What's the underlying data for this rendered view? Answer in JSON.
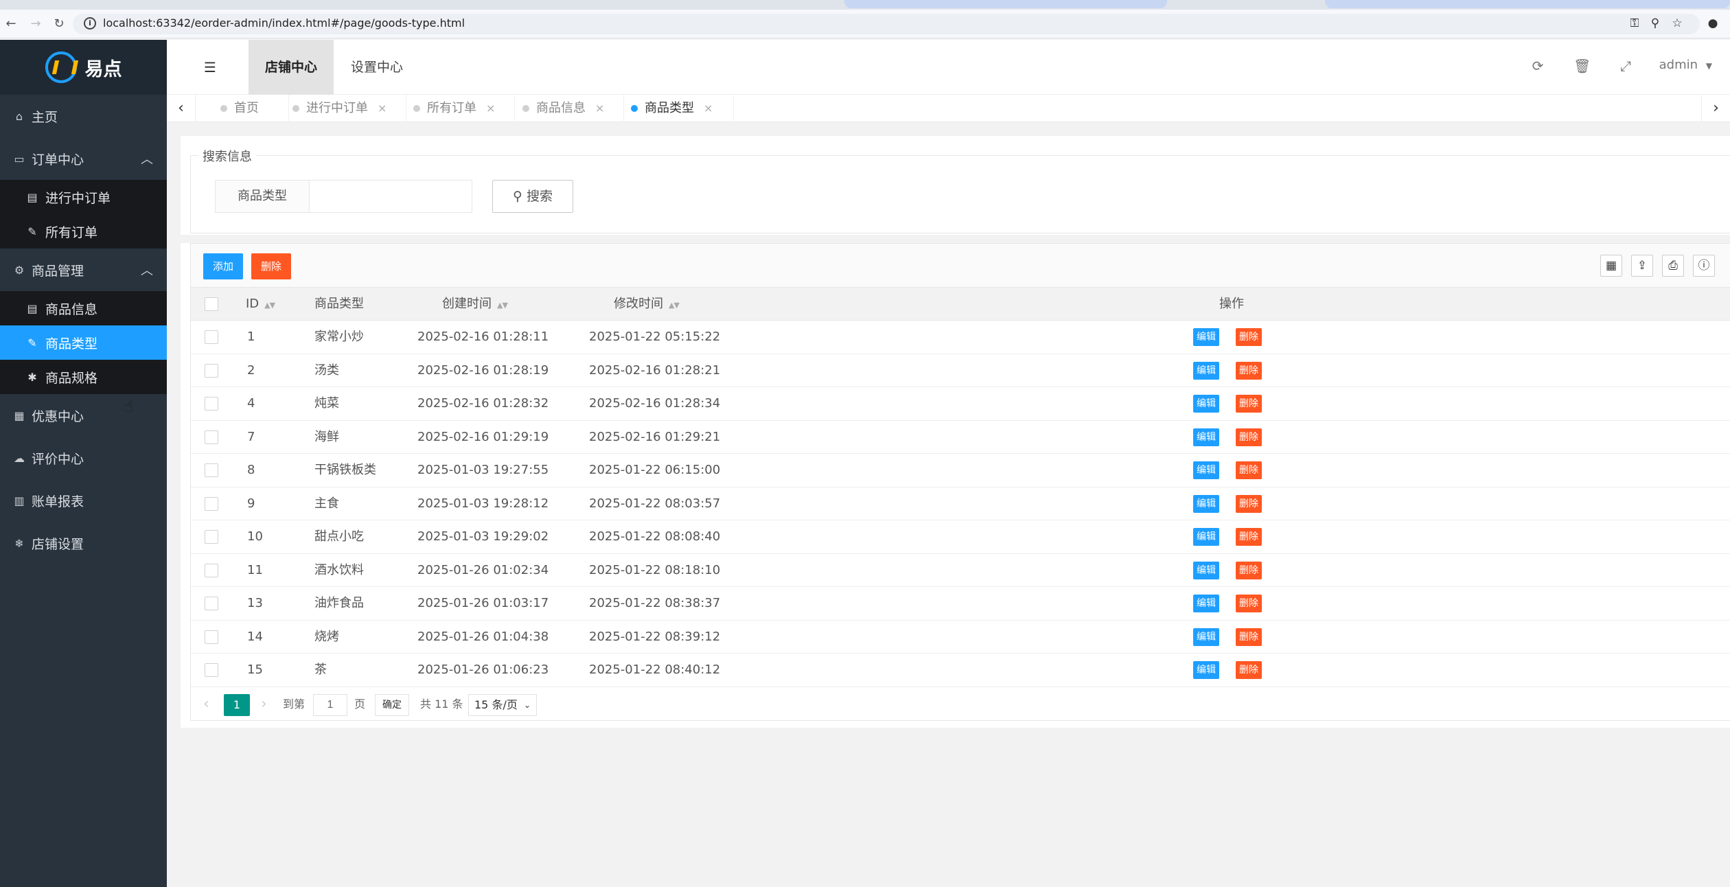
{
  "browser": {
    "url": "localhost:63342/eorder-admin/index.html#/page/goods-type.html"
  },
  "brand": {
    "name": "易点"
  },
  "sidebar": {
    "home": "主页",
    "order_center": "订单中心",
    "order_sub": [
      "进行中订单",
      "所有订单"
    ],
    "goods_manage": "商品管理",
    "goods_sub": [
      "商品信息",
      "商品类型",
      "商品规格"
    ],
    "bottom": [
      "优惠中心",
      "评价中心",
      "账单报表",
      "店铺设置"
    ]
  },
  "header": {
    "tabs": [
      "店铺中心",
      "设置中心"
    ],
    "user": "admin"
  },
  "page_tabs": [
    "首页",
    "进行中订单",
    "所有订单",
    "商品信息",
    "商品类型"
  ],
  "search": {
    "legend": "搜索信息",
    "label": "商品类型",
    "value": "",
    "button": "搜索"
  },
  "toolbar": {
    "add": "添加",
    "delete": "删除"
  },
  "table": {
    "headers": [
      "ID",
      "商品类型",
      "创建时间",
      "修改时间",
      "操作"
    ],
    "edit_label": "编辑",
    "delete_label": "删除",
    "rows": [
      {
        "id": "1",
        "type": "家常小炒",
        "created": "2025-02-16 01:28:11",
        "modified": "2025-01-22 05:15:22"
      },
      {
        "id": "2",
        "type": "汤类",
        "created": "2025-02-16 01:28:19",
        "modified": "2025-02-16 01:28:21"
      },
      {
        "id": "4",
        "type": "炖菜",
        "created": "2025-02-16 01:28:32",
        "modified": "2025-02-16 01:28:34"
      },
      {
        "id": "7",
        "type": "海鲜",
        "created": "2025-02-16 01:29:19",
        "modified": "2025-02-16 01:29:21"
      },
      {
        "id": "8",
        "type": "干锅铁板类",
        "created": "2025-01-03 19:27:55",
        "modified": "2025-01-22 06:15:00"
      },
      {
        "id": "9",
        "type": "主食",
        "created": "2025-01-03 19:28:12",
        "modified": "2025-01-22 08:03:57"
      },
      {
        "id": "10",
        "type": "甜点小吃",
        "created": "2025-01-03 19:29:02",
        "modified": "2025-01-22 08:08:40"
      },
      {
        "id": "11",
        "type": "酒水饮料",
        "created": "2025-01-26 01:02:34",
        "modified": "2025-01-22 08:18:10"
      },
      {
        "id": "13",
        "type": "油炸食品",
        "created": "2025-01-26 01:03:17",
        "modified": "2025-01-22 08:38:37"
      },
      {
        "id": "14",
        "type": "烧烤",
        "created": "2025-01-26 01:04:38",
        "modified": "2025-01-22 08:39:12"
      },
      {
        "id": "15",
        "type": "茶",
        "created": "2025-01-26 01:06:23",
        "modified": "2025-01-22 08:40:12"
      }
    ]
  },
  "pagination": {
    "current": "1",
    "goto_label": "到第",
    "page_input": "1",
    "page_unit": "页",
    "confirm": "确定",
    "total": "共 11 条",
    "page_size": "15 条/页"
  },
  "colors": {
    "sidebar_bg": "#28333e",
    "active_blue": "#1e9fff",
    "danger": "#ff5722",
    "pager_current": "#009688"
  }
}
